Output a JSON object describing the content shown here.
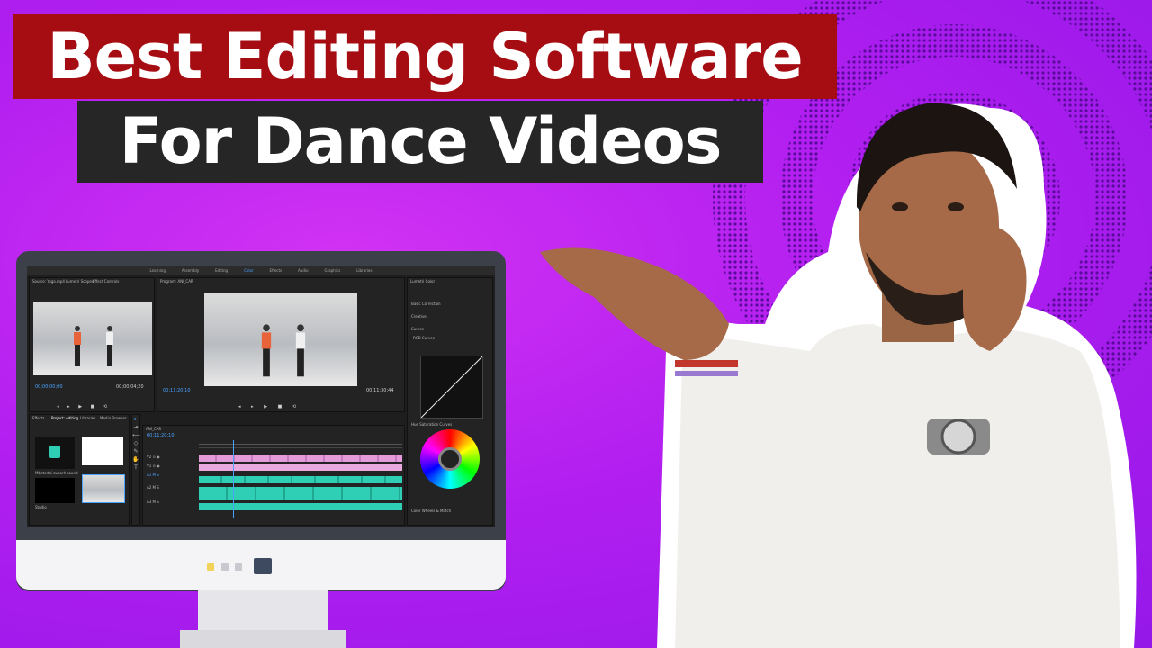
{
  "title": {
    "line1": "Best Editing Software",
    "line2": "For Dance Videos"
  },
  "workspace_tabs": [
    "Learning",
    "Assembly",
    "Editing",
    "Color",
    "Effects",
    "Audio",
    "Graphics",
    "Libraries"
  ],
  "panels": {
    "source_tabs": [
      "Source: Yoga.mp4",
      "Lumetri Scopes",
      "Effect Controls",
      "Audio Clip Mixer: YH"
    ],
    "program_tab": "Program: ANI_CAR",
    "lumetri_tab": "Lumetri Color",
    "project_tabs": [
      "Effects",
      "Project: editing",
      "Libraries",
      "Media Browser"
    ],
    "timeline_tab": "ANI_CAR"
  },
  "timecodes": {
    "source_in": "00;00;00;00",
    "source_out": "00;00;04;20",
    "program_in": "00;11;20;10",
    "program_out": "00;11;30;44",
    "timeline": "00;11;20;10"
  },
  "lumetri_sections": [
    "Basic Correction",
    "Creative",
    "Curves",
    "RGB Curves",
    "Hue Saturation Curves",
    "Color Wheels & Match"
  ],
  "project_items": [
    "Mbeterfai zuparh sound",
    "Studio"
  ],
  "colors": {
    "title1_bg": "#a60d12",
    "title2_bg": "#262626",
    "accent": "#2d8ceb",
    "clip_teal": "#2fcfb5",
    "clip_pink": "#e59ad9"
  }
}
